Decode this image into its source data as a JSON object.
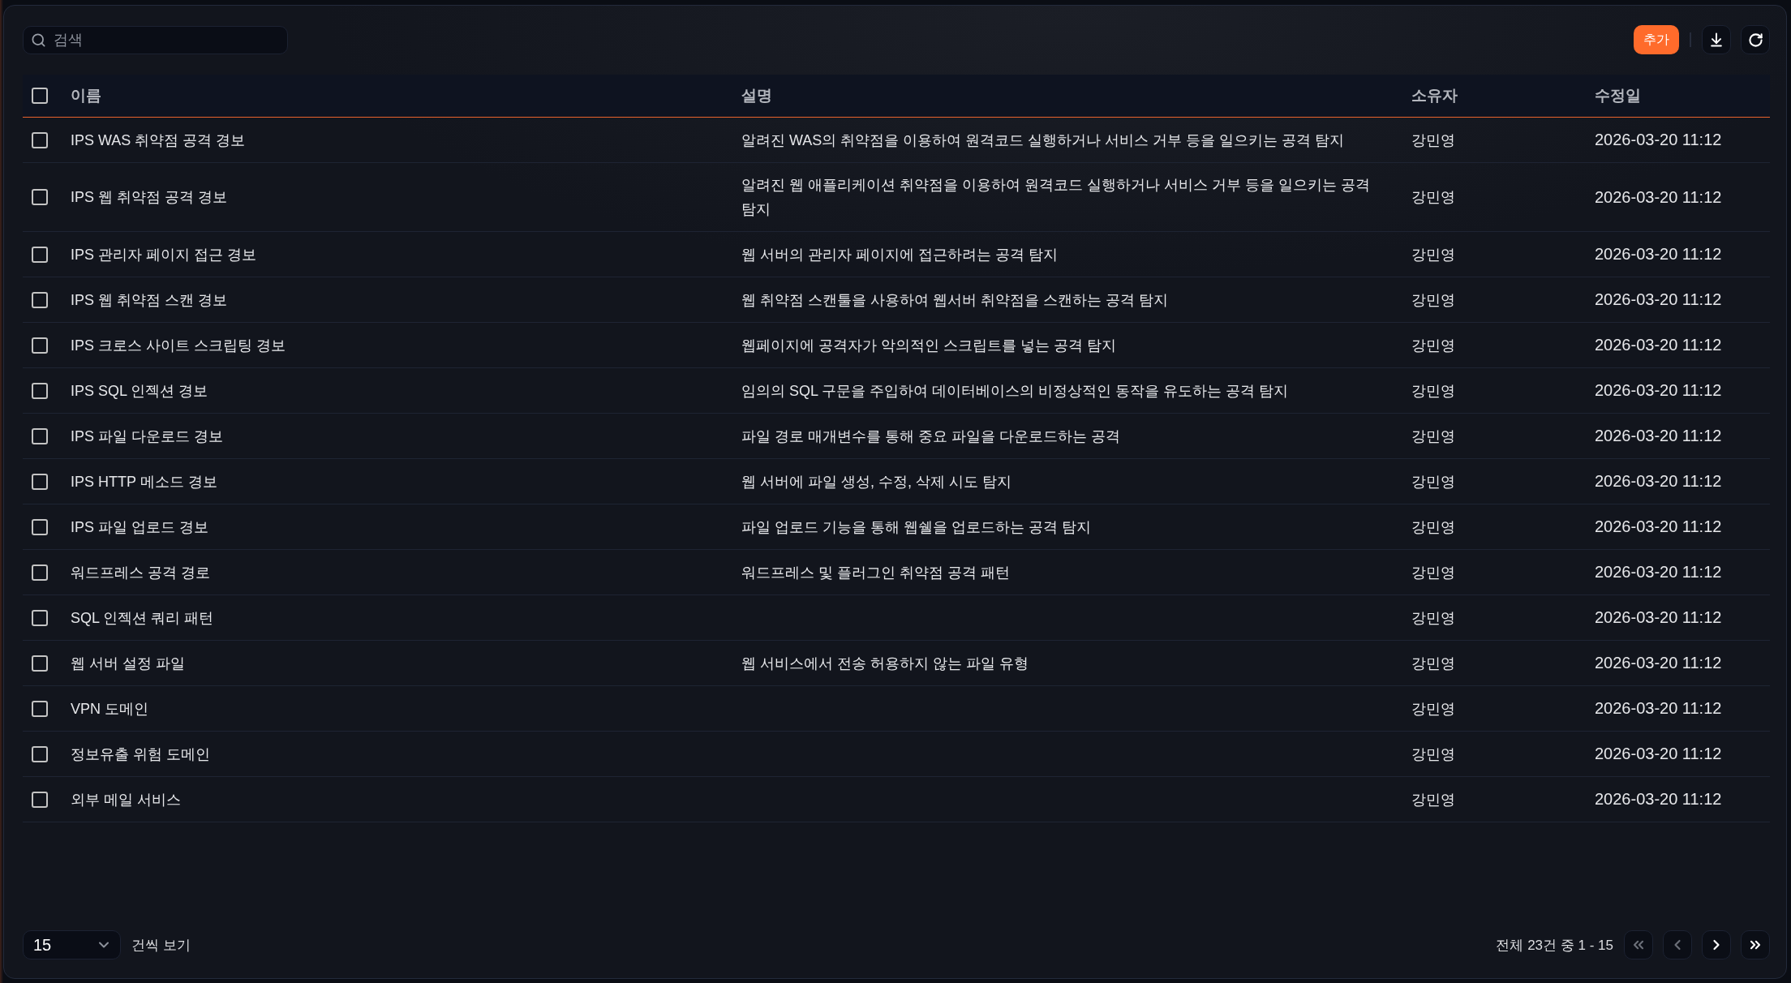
{
  "toolbar": {
    "search": {
      "placeholder": "검색"
    },
    "add_button": "추가"
  },
  "table": {
    "select_all": {
      "checked": false
    },
    "columns": [
      "이름",
      "설명",
      "소유자",
      "수정일"
    ],
    "rows": [
      {
        "checked": false,
        "name": "IPS WAS 취약점 공격 경보",
        "description": "알려진 WAS의 취약점을 이용하여 원격코드 실행하거나 서비스 거부 등을 일으키는 공격 탐지",
        "owner": "강민영",
        "modified": "2026-03-20 11:12"
      },
      {
        "checked": false,
        "name": "IPS 웹 취약점 공격 경보",
        "description": "알려진 웹 애플리케이션 취약점을 이용하여 원격코드 실행하거나 서비스 거부 등을 일으키는 공격 탐지",
        "owner": "강민영",
        "modified": "2026-03-20 11:12"
      },
      {
        "checked": false,
        "name": "IPS 관리자 페이지 접근 경보",
        "description": "웹 서버의 관리자 페이지에 접근하려는 공격 탐지",
        "owner": "강민영",
        "modified": "2026-03-20 11:12"
      },
      {
        "checked": false,
        "name": "IPS 웹 취약점 스캔 경보",
        "description": "웹 취약점 스캔툴을 사용하여 웹서버 취약점을 스캔하는 공격 탐지",
        "owner": "강민영",
        "modified": "2026-03-20 11:12"
      },
      {
        "checked": false,
        "name": "IPS 크로스 사이트 스크립팅 경보",
        "description": "웹페이지에 공격자가 악의적인 스크립트를 넣는 공격 탐지",
        "owner": "강민영",
        "modified": "2026-03-20 11:12"
      },
      {
        "checked": false,
        "name": "IPS SQL 인젝션 경보",
        "description": "임의의 SQL 구문을 주입하여 데이터베이스의 비정상적인 동작을 유도하는 공격 탐지",
        "owner": "강민영",
        "modified": "2026-03-20 11:12"
      },
      {
        "checked": false,
        "name": "IPS 파일 다운로드 경보",
        "description": "파일 경로 매개변수를 통해 중요 파일을 다운로드하는 공격",
        "owner": "강민영",
        "modified": "2026-03-20 11:12"
      },
      {
        "checked": false,
        "name": "IPS HTTP 메소드 경보",
        "description": "웹 서버에 파일 생성, 수정, 삭제 시도 탐지",
        "owner": "강민영",
        "modified": "2026-03-20 11:12"
      },
      {
        "checked": false,
        "name": "IPS 파일 업로드 경보",
        "description": "파일 업로드 기능을 통해 웹쉘을 업로드하는 공격 탐지",
        "owner": "강민영",
        "modified": "2026-03-20 11:12"
      },
      {
        "checked": false,
        "name": "워드프레스 공격 경로",
        "description": "워드프레스 및 플러그인 취약점 공격 패턴",
        "owner": "강민영",
        "modified": "2026-03-20 11:12"
      },
      {
        "checked": false,
        "name": "SQL 인젝션 쿼리 패턴",
        "owner": "강민영",
        "modified": "2026-03-20 11:12"
      },
      {
        "checked": false,
        "name": "웹 서버 설정 파일",
        "description": "웹 서비스에서 전송 허용하지 않는 파일 유형",
        "owner": "강민영",
        "modified": "2026-03-20 11:12"
      },
      {
        "checked": false,
        "name": "VPN 도메인",
        "owner": "강민영",
        "modified": "2026-03-20 11:12"
      },
      {
        "checked": false,
        "name": "정보유출 위험 도메인",
        "owner": "강민영",
        "modified": "2026-03-20 11:12"
      },
      {
        "checked": false,
        "name": "외부 메일 서비스",
        "owner": "강민영",
        "modified": "2026-03-20 11:12"
      }
    ]
  },
  "footer": {
    "page_size": "15",
    "page_size_label": "건씩 보기",
    "summary": "전체 23건 중 1 - 15",
    "pager": [
      {
        "kind": "first",
        "disabled": true
      },
      {
        "kind": "previous",
        "disabled": true
      },
      {
        "kind": "next",
        "disabled": false
      },
      {
        "kind": "last",
        "disabled": false
      }
    ]
  }
}
